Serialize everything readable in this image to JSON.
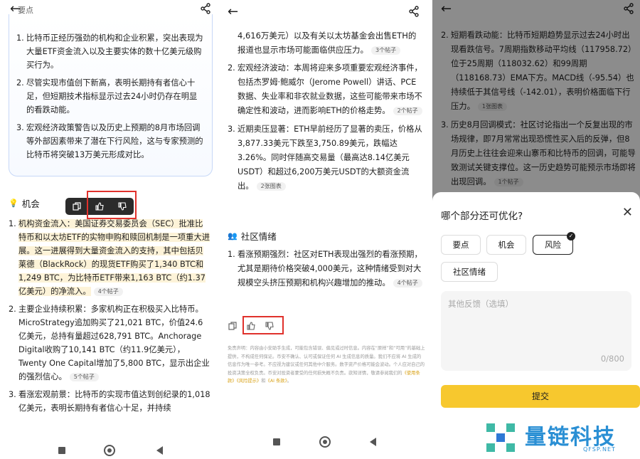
{
  "panel1": {
    "cut_header": "要点",
    "summary_items": [
      {
        "n": "1.",
        "text": "比特币正经历强劲的机构和企业积累，突出表现为大量ETF资金流入以及主要实体的数十亿美元级购买行为。"
      },
      {
        "n": "2.",
        "text": "尽管实现市值创下新高，表明长期持有者信心十足，但短期技术指标显示过去24小时仍存在明显的看跌动能。"
      },
      {
        "n": "3.",
        "text": "宏观经济政策警告以及历史上预期的8月市场回调等外部因素带来了潜在下行风险，这与专家预测的比特币将突破13万美元形成对比。"
      }
    ],
    "section_title": "机会",
    "items": [
      {
        "n": "1.",
        "text": "机构资金流入：美国证券交易委员会（SEC）批准比特币和以太坊ETF的实物申购和赎回机制是一项重大进展。这一进展得到大量资金流入的支持，其中包括贝莱德（BlackRock）的现货ETF购买了1,340 BTC和1,249 BTC，为比特币ETF带来1,163 BTC（约1.37亿美元）的净流入。",
        "chip": "4个帖子"
      },
      {
        "n": "2.",
        "text": "主要企业持续积累：多家机构正在积极买入比特币。MicroStrategy追加购买了21,021 BTC，价值24.6亿美元，总持有量超过628,791 BTC。Anchorage Digital收购了10,141 BTC（约11.9亿美元），Twenty One Capital增加了5,800 BTC，显示出企业的强烈信心。",
        "chip": "5个帖子"
      },
      {
        "n": "3.",
        "text": "看涨宏观前景：比特币的实现市值达到创纪录的1,018亿美元，表明长期持有者信心十足，并持续"
      }
    ]
  },
  "panel2": {
    "lead_text": "4,616万美元）以及有关以太坊基金会出售ETH的报道也显示市场可能面临供应压力。",
    "lead_chip": "3个帖子",
    "items": [
      {
        "n": "2.",
        "text": "宏观经济波动：本周将迎来多项重要宏观经济事件，包括杰罗姆·鲍威尔（Jerome Powell）讲话、PCE数据、失业率和非农就业数据，这些可能带来市场不确定性和波动，进而影响ETH的价格走势。",
        "chip": "2个帖子"
      },
      {
        "n": "3.",
        "text": "近期卖压显著：ETH早前经历了显著的卖压，价格从3,877.33美元下跌至3,750.89美元，跌幅达3.26%。同时伴随高交易量（最高达8.14亿美元USDT）和超过6,200万美元USDT的大额资金流出。",
        "chip": "2张图表"
      }
    ],
    "section_title": "社区情绪",
    "community_items": [
      {
        "n": "1.",
        "text": "看涨预期强烈：社区对ETH表现出强烈的看涨预期，尤其是期待价格突破4,000美元，这种情绪受到对大规模空头挤压预期和机构兴趣增加的推动。",
        "chip": "4个帖子"
      }
    ],
    "disclaimer": "免责声明：内容由小安助手生成，可能包含错误、偏见或过时信息。内容在“原样”和“可用”的基础上提供，不构成任何保证。币安不确认、认可或保证任何 AI 生成信息的质量。我们不应将 AI 生成的信息作为唯一参考。不应视为建议或任何其他中介服务。数字资产价格可能会波动。个人应对自己的投资决策全权负责。币安对投资者蒙受的任何损失概不负责。欲知详情，敬请参阅我们的",
    "disclaimer_links": [
      "《使用条款》",
      "《风险提示》",
      "《AI 条款》"
    ],
    "disclaimer_and": "和",
    "disclaimer_end": "。"
  },
  "panel3": {
    "items": [
      {
        "n": "2.",
        "text": "短期看跌动能：比特币短期趋势显示过去24小时出现看跌信号。7周期指数移动平均线（117958.72）位于25周期（118032.62）和99周期（118168.73）EMA下方。MACD线（-95.54）也持续低于其信号线（-142.01），表明价格面临下行压力。",
        "chip": "1张图表"
      },
      {
        "n": "3.",
        "text": "历史8月回调模式：社区讨论指出一个反复出现的市场规律，即7月常常出现恐慌性买入后的反弹，但8月历史上往往会迎来山寨币和比特币的回调，可能导致测试关键支撑位。这一历史趋势可能预示市场即将出现回调。",
        "chip": "1个帖子"
      }
    ],
    "sheet_title": "哪个部分还可优化?",
    "options": [
      "要点",
      "机会",
      "风险",
      "社区情绪"
    ],
    "selected_option": "风险",
    "textarea_placeholder": "其他反馈（选填）",
    "counter": "0/800",
    "submit_label": "提交"
  },
  "popup": {
    "copy": "copy-icon",
    "like": "thumbs-up-icon",
    "dislike": "thumbs-down-icon"
  },
  "watermark": {
    "name": "量链科技",
    "url": "QFSP.NET"
  },
  "colors": {
    "highlight": "#fdf3d8",
    "red_box": "#e0312c",
    "accent_yellow": "#f7c82e",
    "chip_bg": "#f1f1f1"
  }
}
